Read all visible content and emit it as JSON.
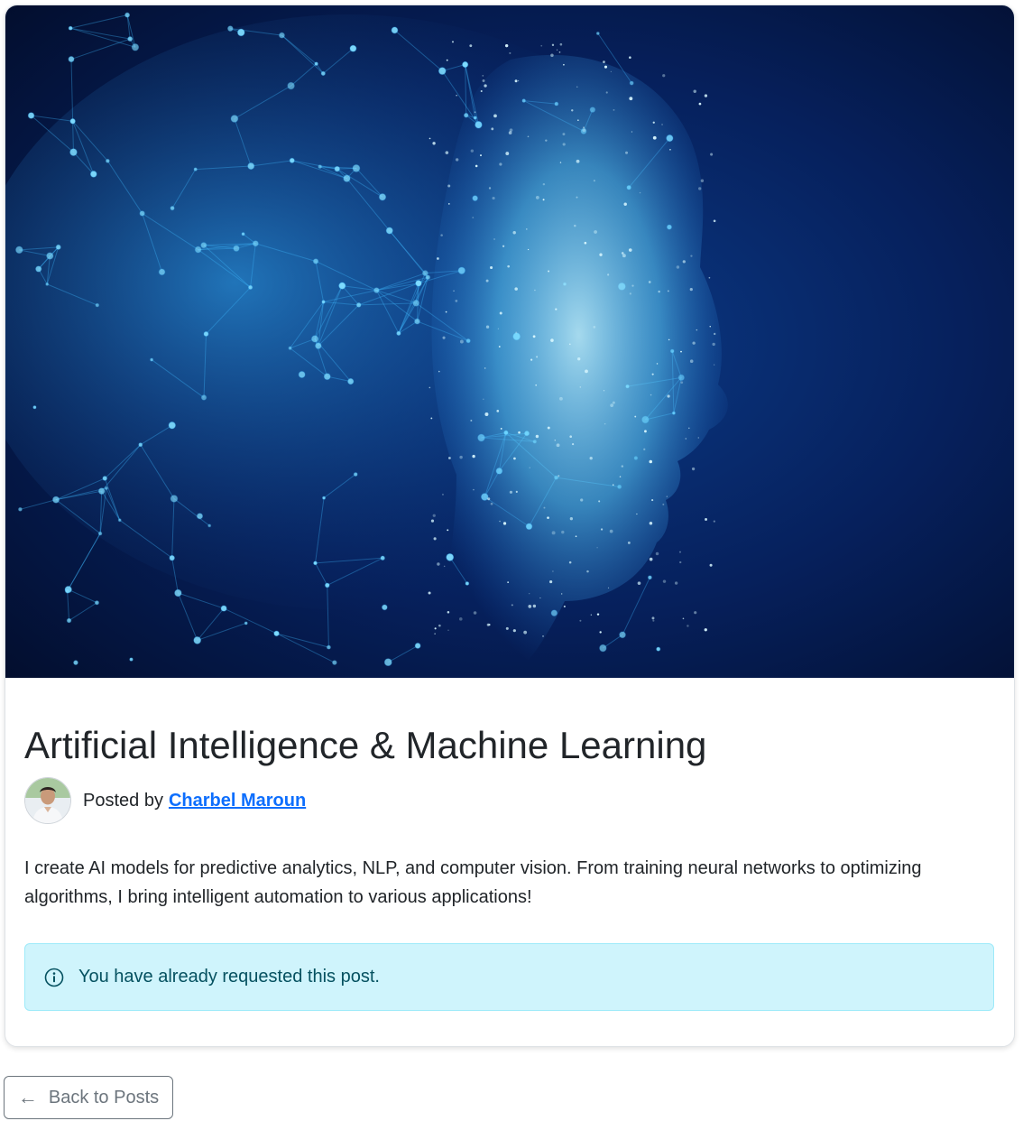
{
  "post": {
    "title": "Artificial Intelligence & Machine Learning",
    "hero_image": "ai-head-neural-network-illustration",
    "posted_by_label": "Posted by",
    "author_name": "Charbel Maroun",
    "author_avatar": "author-avatar-photo",
    "description": "I create AI models for predictive analytics, NLP, and computer vision. From training neural networks to optimizing algorithms, I bring intelligent automation to various applications!"
  },
  "alert": {
    "icon": "info-icon",
    "message": "You have already requested this post."
  },
  "navigation": {
    "back_icon": "arrow-left-icon",
    "back_label": "Back to Posts"
  },
  "colors": {
    "link": "#0d6efd",
    "alert_bg": "#cff4fc",
    "alert_border": "#9eeaf9",
    "alert_text": "#055160",
    "secondary": "#6c757d",
    "hero_bg": "#04123a",
    "hero_glow": "#38b6ff"
  }
}
